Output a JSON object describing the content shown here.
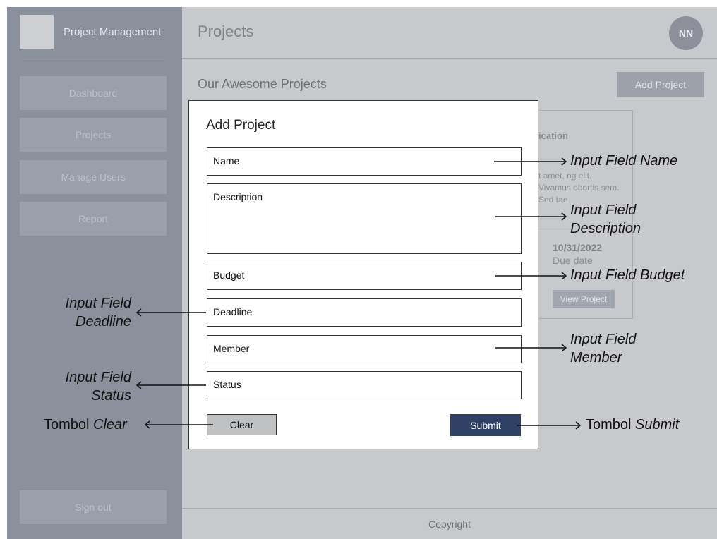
{
  "sidebar": {
    "brand": "Project Management",
    "nav": [
      "Dashboard",
      "Projects",
      "Manage Users",
      "Report"
    ],
    "signout": "Sign out"
  },
  "header": {
    "title": "Projects",
    "avatar_initials": "NN"
  },
  "content": {
    "section_title": "Our Awesome Projects",
    "add_project_label": "Add Project",
    "card": {
      "title": "ication",
      "text": "t amet, ng elit. Vivamus obortis sem. Sed tae",
      "date": "10/31/2022",
      "due_label": "Due date",
      "button": "View Project"
    }
  },
  "footer": {
    "text": "Copyright"
  },
  "modal": {
    "title": "Add Project",
    "fields": {
      "name": "Name",
      "description": "Description",
      "budget": "Budget",
      "deadline": "Deadline",
      "member": "Member",
      "status": "Status"
    },
    "clear_label": "Clear",
    "submit_label": "Submit"
  },
  "annotations": {
    "name": "Input Field Name",
    "description_1": "Input Field",
    "description_2": "Description",
    "budget": "Input Field Budget",
    "deadline_1": "Input Field",
    "deadline_2": "Deadline",
    "member_1": "Input Field",
    "member_2": "Member",
    "status_1": "Input Field",
    "status_2": "Status",
    "clear_prefix": "Tombol",
    "clear_word": "Clear",
    "submit_prefix": "Tombol",
    "submit_word": "Submit"
  },
  "colors": {
    "sidebar": "#8a909c",
    "main_bg": "#c8c9cc",
    "submit": "#2f4266"
  }
}
